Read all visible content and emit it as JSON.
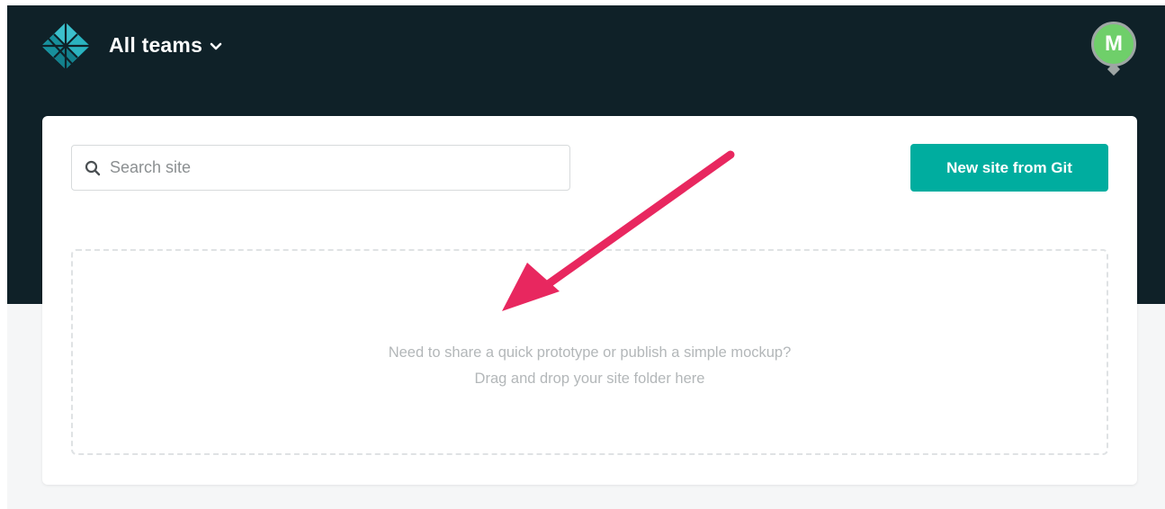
{
  "header": {
    "team_switcher_label": "All teams",
    "logo_icon": "netlify-diamond-icon",
    "chevron_icon": "chevron-down-icon"
  },
  "user": {
    "avatar_initial": "M",
    "avatar_color": "#6fcf6a"
  },
  "toolbar": {
    "search_placeholder": "Search site",
    "search_value": "",
    "new_site_label": "New site from Git"
  },
  "dropzone": {
    "line1": "Need to share a quick prototype or publish a simple mockup?",
    "line2": "Drag and drop your site folder here"
  },
  "colors": {
    "header_bg": "#0f2128",
    "accent": "#00ad9f",
    "annotation_arrow": "#e8275f"
  }
}
